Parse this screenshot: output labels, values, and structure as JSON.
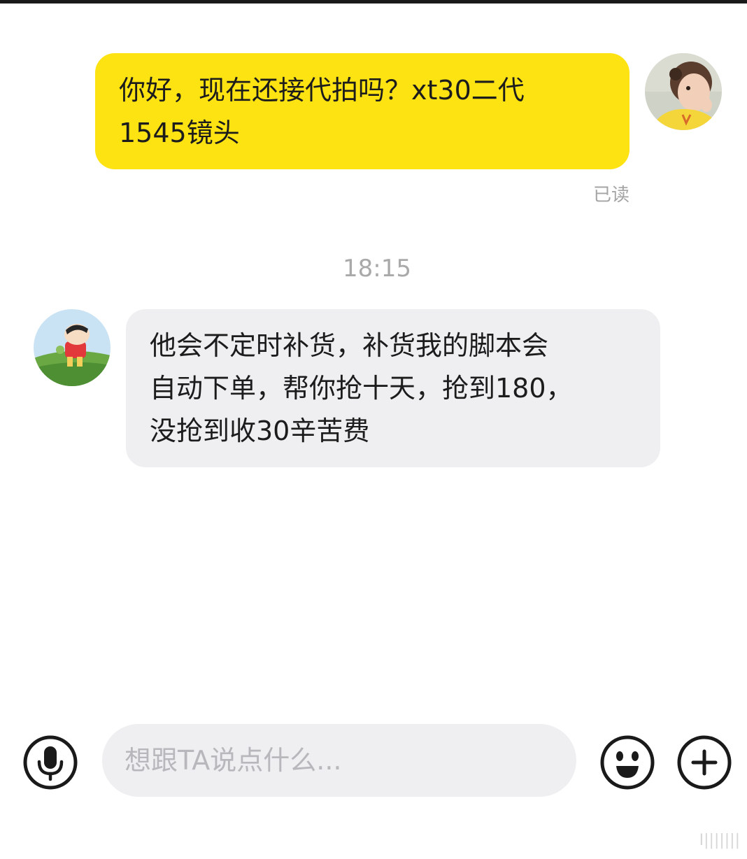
{
  "messages": {
    "outgoing": {
      "lines": [
        "你好，现在还接代拍吗？xt30二代",
        "1545镜头"
      ],
      "bubble_color": "#fde312"
    },
    "read_status": "已读",
    "timestamp": "18:15",
    "incoming": {
      "lines": [
        "他会不定时补货，补货我的脚本会",
        "自动下单，帮你抢十天，抢到180，",
        "没抢到收30辛苦费"
      ],
      "bubble_color": "#efeff2"
    }
  },
  "composer": {
    "placeholder": "想跟TA说点什么...",
    "left_icon": "microphone-icon",
    "right_icons": [
      "emoji-icon",
      "plus-icon"
    ]
  },
  "watermark": "I|||||||"
}
